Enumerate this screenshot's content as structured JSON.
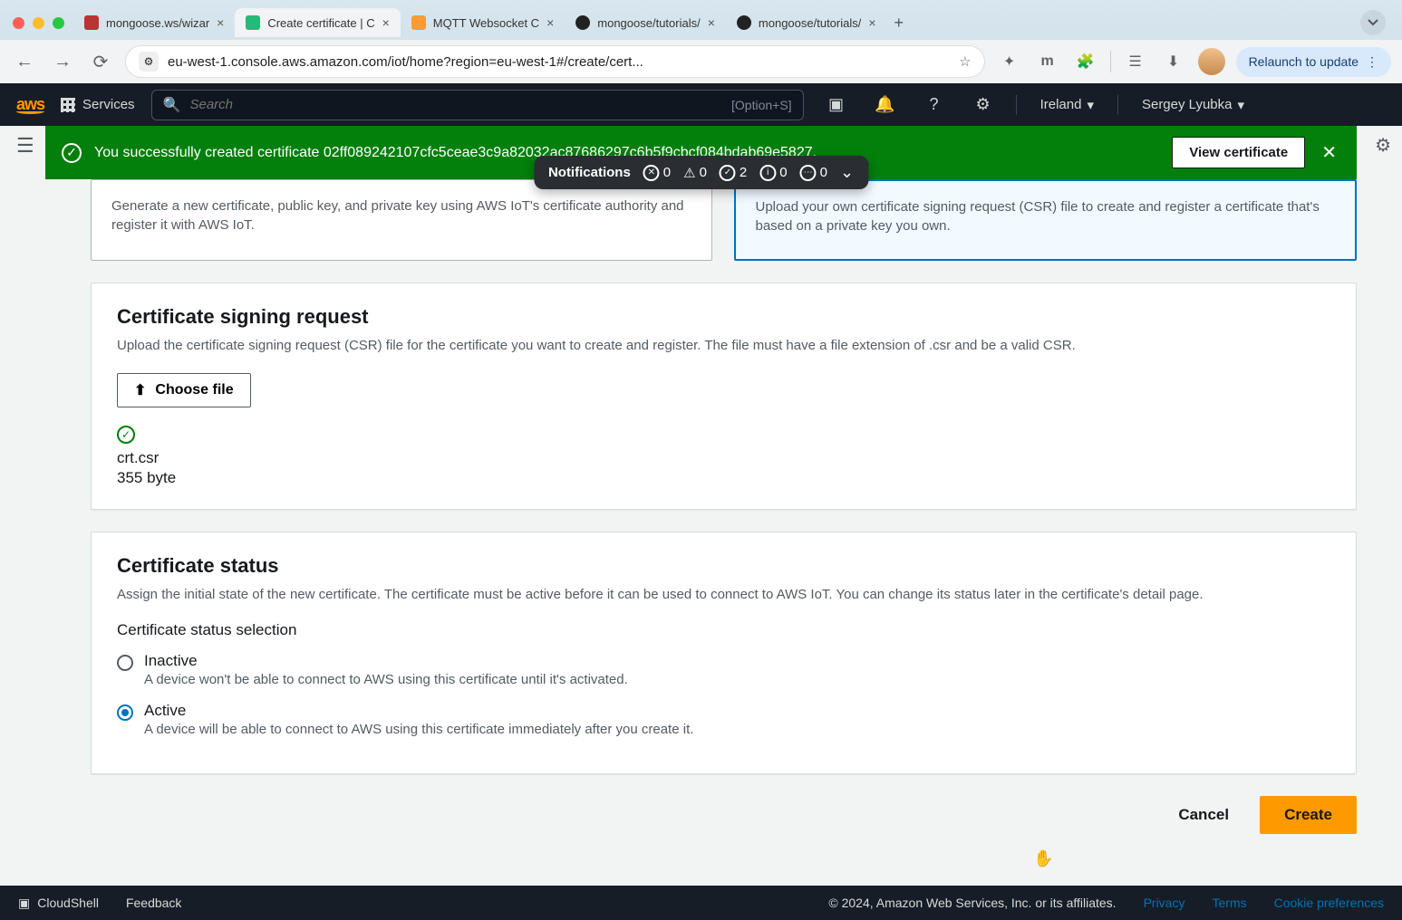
{
  "browser": {
    "tabs": [
      {
        "title": "mongoose.ws/wizar"
      },
      {
        "title": "Create certificate | C"
      },
      {
        "title": "MQTT Websocket C"
      },
      {
        "title": "mongoose/tutorials/"
      },
      {
        "title": "mongoose/tutorials/"
      }
    ],
    "url": "eu-west-1.console.aws.amazon.com/iot/home?region=eu-west-1#/create/cert...",
    "relaunch": "Relaunch to update"
  },
  "aws_header": {
    "services": "Services",
    "search_placeholder": "Search",
    "search_hint": "[Option+S]",
    "region": "Ireland",
    "user": "Sergey Lyubka"
  },
  "flash": {
    "text": "You successfully created certificate 02ff089242107cfc5ceae3c9a82032ac87686297c6b5f9cbcf084bdab69e5827.",
    "button": "View certificate"
  },
  "notifications": {
    "label": "Notifications",
    "error": "0",
    "warn": "0",
    "success": "2",
    "info": "0",
    "other": "0"
  },
  "option1": "Generate a new certificate, public key, and private key using AWS IoT's certificate authority and register it with AWS IoT.",
  "option2": "Upload your own certificate signing request (CSR) file to create and register a certificate that's based on a private key you own.",
  "csr": {
    "heading": "Certificate signing request",
    "desc": "Upload the certificate signing request (CSR) file for the certificate you want to create and register. The file must have a file extension of .csr and be a valid CSR.",
    "choose": "Choose file",
    "filename": "crt.csr",
    "filesize": "355 byte"
  },
  "status": {
    "heading": "Certificate status",
    "desc": "Assign the initial state of the new certificate. The certificate must be active before it can be used to connect to AWS IoT. You can change its status later in the certificate's detail page.",
    "subheading": "Certificate status selection",
    "inactive_label": "Inactive",
    "inactive_desc": "A device won't be able to connect to AWS using this certificate until it's activated.",
    "active_label": "Active",
    "active_desc": "A device will be able to connect to AWS using this certificate immediately after you create it."
  },
  "actions": {
    "cancel": "Cancel",
    "create": "Create"
  },
  "footer": {
    "cloudshell": "CloudShell",
    "feedback": "Feedback",
    "copyright": "© 2024, Amazon Web Services, Inc. or its affiliates.",
    "privacy": "Privacy",
    "terms": "Terms",
    "cookies": "Cookie preferences"
  }
}
